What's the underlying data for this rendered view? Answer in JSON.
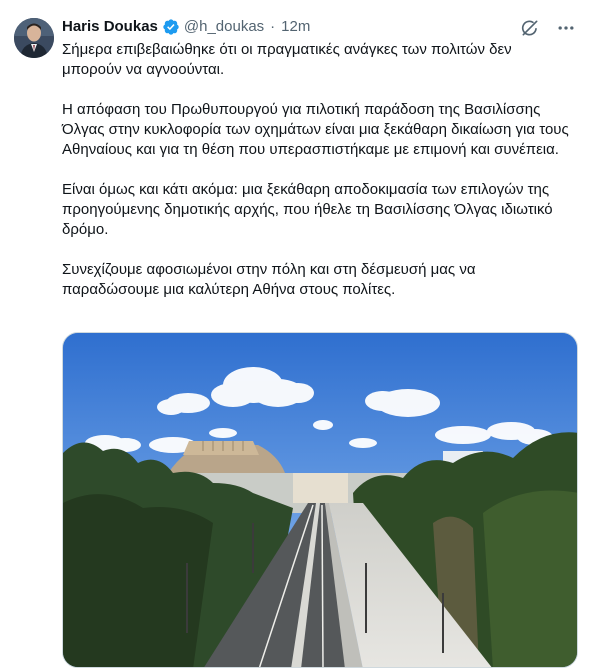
{
  "author": {
    "name": "Haris Doukas",
    "handle": "@h_doukas",
    "separator": "·",
    "time": "12m"
  },
  "tweet": {
    "paragraphs": [
      "Σήμερα επιβεβαιώθηκε ότι οι πραγματικές ανάγκες των πολιτών δεν μπορούν να αγνοούνται.",
      "Η απόφαση του Πρωθυπουργού για πιλοτική παράδοση της Βασιλίσσης Όλγας στην κυκλοφορία των οχημάτων είναι μια ξεκάθαρη δικαίωση για τους Αθηναίους και για τη θέση που υπερασπιστήκαμε με επιμονή και συνέπεια.",
      "Είναι όμως και κάτι ακόμα: μια ξεκάθαρη αποδοκιμασία των επιλογών της προηγούμενης δημοτικής αρχής, που ήθελε τη Βασιλίσσης Όλγας ιδιωτικό δρόμο.",
      "Συνεχίζουμε αφοσιωμένοι στην πόλη και στη δέσμευσή μας να παραδώσουμε μια καλύτερη Αθήνα στους πολίτες."
    ]
  },
  "icons": {
    "verified": "verified-badge-icon",
    "grok": "grok-icon",
    "more": "more-icon"
  },
  "colors": {
    "verified_blue": "#1d9bf0",
    "secondary_text": "#536471",
    "primary_text": "#0f1419"
  }
}
